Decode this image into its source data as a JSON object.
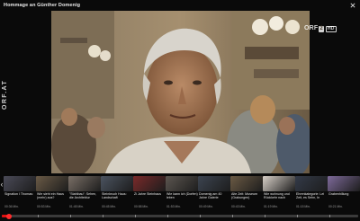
{
  "header": {
    "title": "Hommage an Günther Domenig",
    "corner_icon": "close-icon"
  },
  "brand": {
    "side_text": "ORF.AT"
  },
  "video": {
    "channel_text": "ORF",
    "channel_number": "2",
    "quality": "HD"
  },
  "playlist": {
    "items": [
      {
        "caption": "Signation I Thomas:",
        "meta": "00:36 Min."
      },
      {
        "caption": "Wie sieht ein Haus (mehr) aus?",
        "meta": "00:53 Min."
      },
      {
        "caption": "\"Stahlbau\": Sehen, die Architektur",
        "meta": "01:45 Min."
      },
      {
        "caption": "Steinbruch Haus: Landschaft",
        "meta": "00:45 Min."
      },
      {
        "caption": "Zi Jahre Steinhaus",
        "meta": "00:58 Min."
      },
      {
        "caption": "Wie kann ich (Dorfen) leben",
        "meta": "01:53 Min."
      },
      {
        "caption": "Domenig am 40 Jahre Galerie",
        "meta": "00:49 Min."
      },
      {
        "caption": "Alte Zeit: Museum (Grabungen)",
        "meta": "00:43 Min."
      },
      {
        "caption": "Wie wohnung und Rückkehr nach",
        "meta": "01:19 Min."
      },
      {
        "caption": "Ehrenkategorie: Lei Zeit, es Sehn, In",
        "meta": "01:15 Min."
      },
      {
        "caption": "Grabenhillung",
        "meta": "00:21 Min."
      }
    ],
    "thumb_colors": [
      "#4a4a57",
      "#6a5a46",
      "#7a6f66",
      "#4b5360",
      "#7a2a2a",
      "#5c5650",
      "#3c4450",
      "#6b5a44",
      "#d8d0c8",
      "#333a48",
      "#7e6a9a"
    ]
  },
  "playback": {
    "progress": 0.02,
    "accent": "#e11111"
  }
}
